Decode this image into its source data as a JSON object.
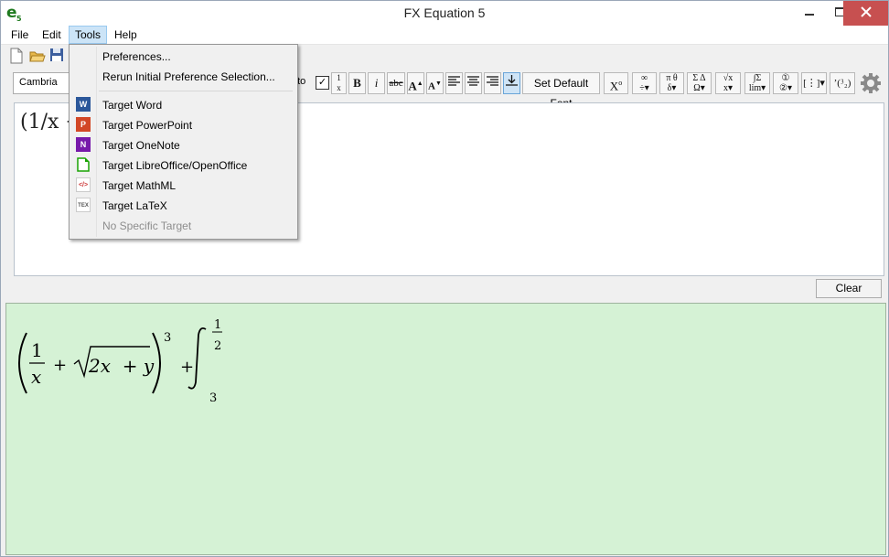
{
  "window": {
    "title": "FX Equation 5",
    "logo_text": "e",
    "logo_sub": "5"
  },
  "menubar": {
    "items": [
      "File",
      "Edit",
      "Tools",
      "Help"
    ],
    "active": "Tools"
  },
  "toolbar": {
    "font_value": "Cambria",
    "auto_label": "uto",
    "auto_checked": "✓",
    "set_default_font_label": "Set Default Font",
    "bold_label": "B",
    "italic_label": "i",
    "strike_label": "abc"
  },
  "editor": {
    "text": "(1/x +"
  },
  "clear_label": "Clear",
  "tools_menu": {
    "items": [
      {
        "label": "Preferences...",
        "icon": "none",
        "enabled": true
      },
      {
        "label": "Rerun Initial Preference Selection...",
        "icon": "none",
        "enabled": true
      },
      {
        "label": "Target Word",
        "icon": "word-icon",
        "enabled": true
      },
      {
        "label": "Target PowerPoint",
        "icon": "powerpoint-icon",
        "enabled": true
      },
      {
        "label": "Target OneNote",
        "icon": "onenote-icon",
        "enabled": true
      },
      {
        "label": "Target LibreOffice/OpenOffice",
        "icon": "libreoffice-icon",
        "enabled": true
      },
      {
        "label": "Target MathML",
        "icon": "mathml-icon",
        "enabled": true
      },
      {
        "label": "Target LaTeX",
        "icon": "latex-icon",
        "enabled": true
      },
      {
        "label": "No Specific Target",
        "icon": "none",
        "enabled": false
      }
    ]
  },
  "preview": {
    "frac_num": "1",
    "frac_den": "x",
    "plus": "+",
    "radicand": "2x  + y",
    "power": "3",
    "plus2": "+",
    "upper_limit_num": "1",
    "upper_limit_den": "2",
    "lower_limit": "3"
  },
  "colors": {
    "preview_bg": "#d5f2d5",
    "close_button": "#c75050",
    "menu_highlight": "#cce4f7"
  }
}
